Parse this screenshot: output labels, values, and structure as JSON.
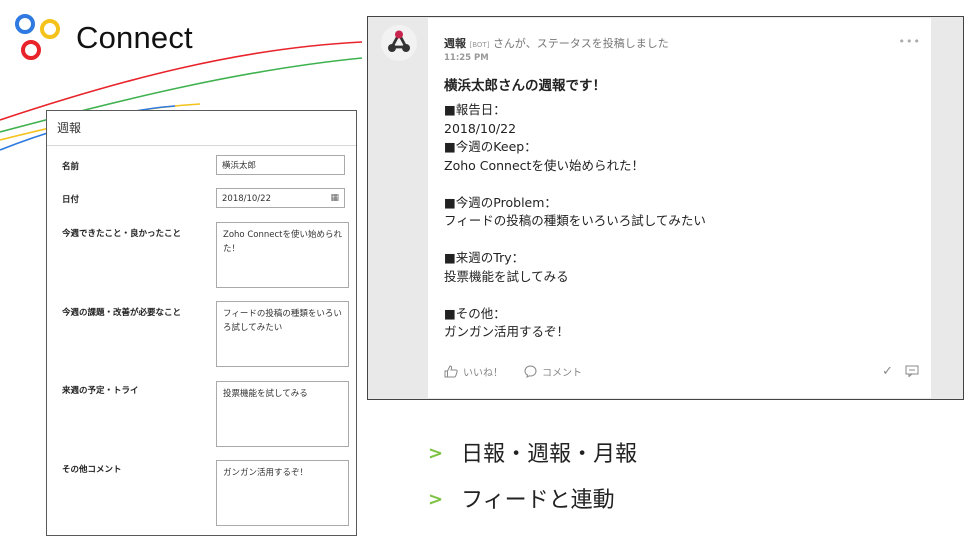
{
  "brand": {
    "logo_text": "Connect"
  },
  "form": {
    "title": "週報",
    "fields": [
      {
        "label": "名前",
        "value": "横浜太郎"
      },
      {
        "label": "日付",
        "value": "2018/10/22"
      },
      {
        "label": "今週できたこと・良かったこと",
        "lines": [
          "Zoho Connectを使い始められ",
          "た！"
        ]
      },
      {
        "label": "今週の課題・改善が必要なこと",
        "lines": [
          "フィードの投稿の種類をいろい",
          "ろ試してみたい"
        ]
      },
      {
        "label": "来週の予定・トライ",
        "lines": [
          "投票機能を試してみる"
        ]
      },
      {
        "label": "その他コメント",
        "lines": [
          "ガンガン活用するぞ！"
        ]
      }
    ]
  },
  "feed": {
    "author": "週報",
    "bot_tag": "[BOT]",
    "action_text": "さんが、ステータスを投稿しました",
    "time": "11:25 PM",
    "more_icon": "more-dots-icon",
    "post_title": "横浜太郎さんの週報です！",
    "post_lines": [
      "■報告日：",
      "2018/10/22",
      "■今週のKeep：",
      "Zoho Connectを使い始められた！",
      "",
      "■今週のProblem：",
      "フィードの投稿の種類をいろいろ試してみたい",
      "",
      "■来週のTry：",
      "投票機能を試してみる",
      "",
      "■その他：",
      "ガンガン活用するぞ！"
    ],
    "like_label": "いいね！",
    "comment_label": "コメント"
  },
  "bullets": [
    {
      "marker": ">",
      "text": "日報・週報・月報"
    },
    {
      "marker": ">",
      "text": "フィードと連動"
    }
  ],
  "colors": {
    "bullet_marker": "#7dc242",
    "logo_blue": "#2f7ae0",
    "logo_red": "#e8232a",
    "logo_yellow": "#f4c21a"
  }
}
